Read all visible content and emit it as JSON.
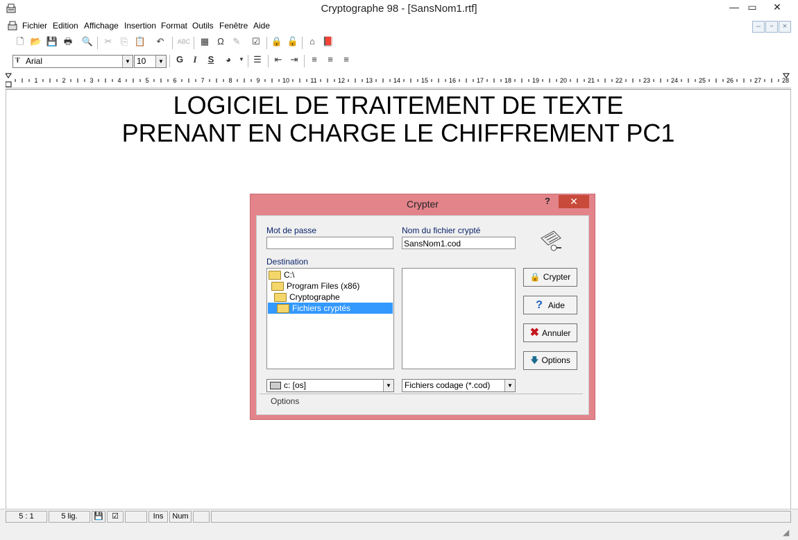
{
  "window": {
    "title": "Cryptographe 98 - [SansNom1.rtf]",
    "min": "—",
    "max": "▭",
    "close": "✕"
  },
  "menu": [
    "Fichier",
    "Edition",
    "Affichage",
    "Insertion",
    "Format",
    "Outils",
    "Fenêtre",
    "Aide"
  ],
  "mdi": {
    "min": "–",
    "restore": "▫",
    "close": "×"
  },
  "format_toolbar": {
    "font": "Arial",
    "size": "10",
    "bold": "G",
    "italic": "I",
    "underline": "S"
  },
  "ruler": {
    "numbers": [
      "1",
      "2",
      "3",
      "4",
      "5",
      "6",
      "7",
      "8",
      "9",
      "10",
      "11",
      "12",
      "13",
      "14",
      "15",
      "16",
      "17",
      "18",
      "19",
      "20",
      "21",
      "22",
      "23",
      "24",
      "25",
      "26",
      "27",
      "28"
    ]
  },
  "document": {
    "line1": "LOGICIEL DE TRAITEMENT DE TEXTE",
    "line2": "PRENANT EN CHARGE LE CHIFFREMENT PC1"
  },
  "dialog": {
    "title": "Crypter",
    "help": "?",
    "password_label": "Mot de passe",
    "password_value": "",
    "filename_label": "Nom du fichier crypté",
    "filename_value": "SansNom1.cod",
    "destination_label": "Destination",
    "tree": [
      "C:\\",
      "Program Files (x86)",
      "Cryptographe",
      "Fichiers cryptés"
    ],
    "drive": "c: [os]",
    "filetype": "Fichiers codage (*.cod)",
    "buttons": {
      "crypter": "Crypter",
      "aide": "Aide",
      "annuler": "Annuler",
      "options": "Options"
    },
    "options_group": "Options"
  },
  "status": {
    "position": "5 : 1",
    "lines": "5 lig.",
    "ins": "Ins",
    "num": "Num"
  },
  "colors": {
    "dialog_frame": "#e3838a",
    "selection": "#3399ff",
    "close": "#c84a3a"
  }
}
